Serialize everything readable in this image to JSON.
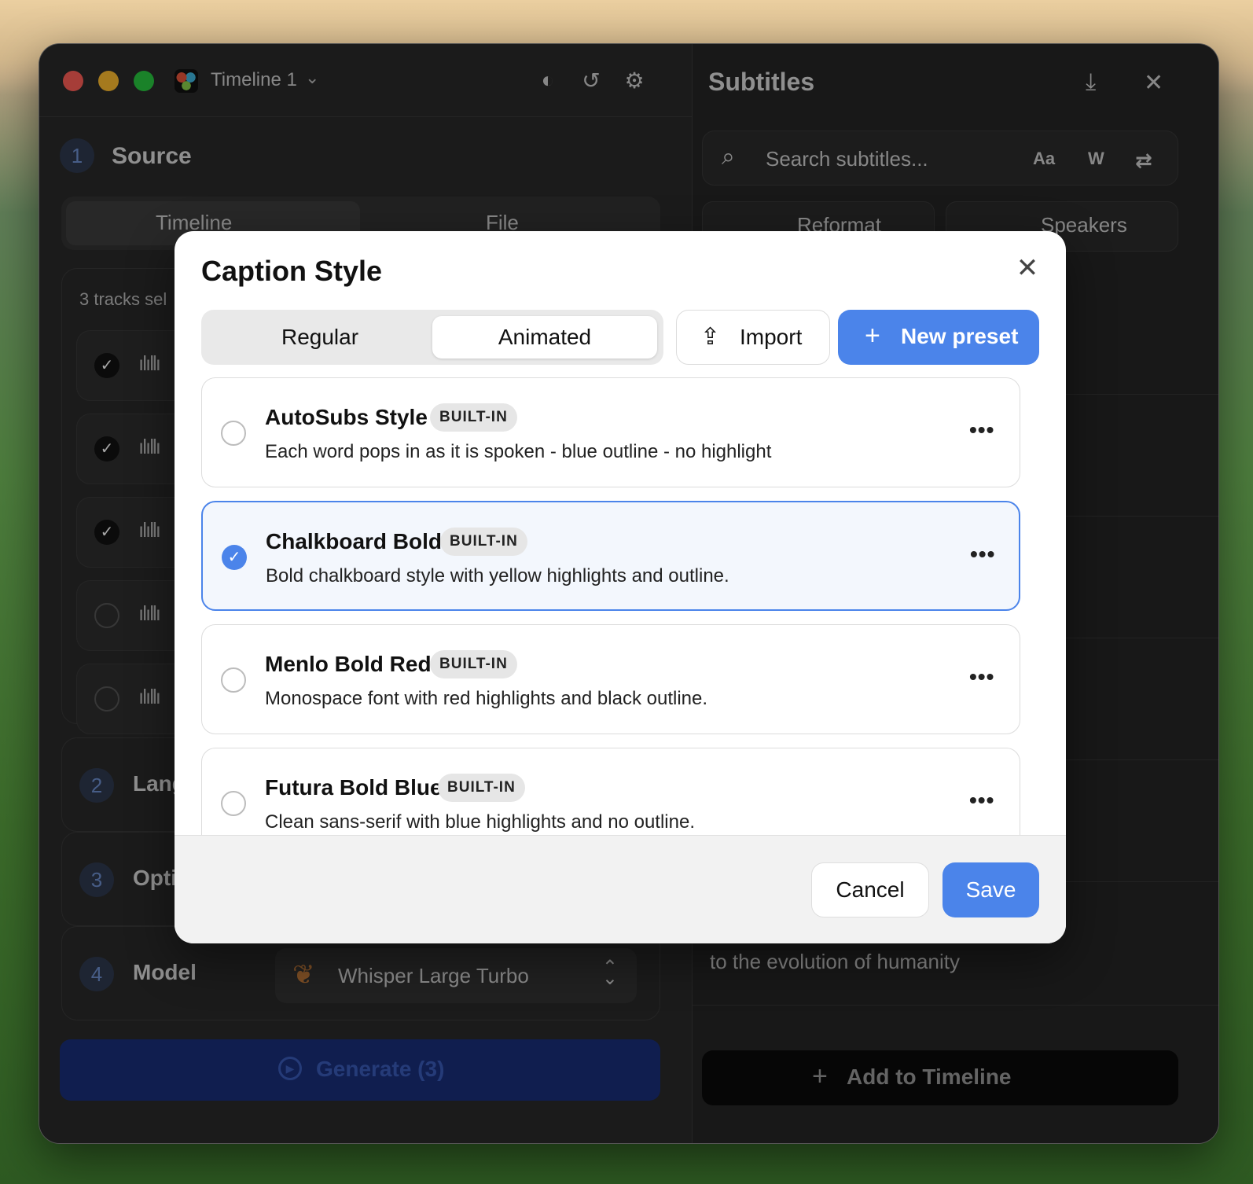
{
  "window": {
    "timeline_title": "Timeline 1"
  },
  "left": {
    "step1_num": "1",
    "step1_label": "Source",
    "source_tabs": [
      "Timeline",
      "File"
    ],
    "tracks_label": "3 tracks sel",
    "step2_num": "2",
    "step2_label": "Lang",
    "step3_num": "3",
    "step3_label": "Opti",
    "step4_num": "4",
    "step4_label": "Model",
    "model_value": "Whisper Large Turbo",
    "generate_label": "Generate (3)"
  },
  "right": {
    "title": "Subtitles",
    "search_placeholder": "Search subtitles...",
    "search_opt_case": "Aa",
    "search_opt_word": "W",
    "tab_reformat": "Reformat",
    "tab_speakers": "Speakers",
    "visible_subtitle": "to the evolution of humanity",
    "add_to_timeline": "Add to Timeline"
  },
  "modal": {
    "title": "Caption Style",
    "tabs": [
      "Regular",
      "Animated"
    ],
    "active_tab": "Animated",
    "import_label": "Import",
    "new_preset_label": "New preset",
    "presets": [
      {
        "name": "AutoSubs Style",
        "badge": "BUILT-IN",
        "description": "Each word pops in as it is spoken - blue outline - no highlight",
        "selected": false
      },
      {
        "name": "Chalkboard Bold",
        "badge": "BUILT-IN",
        "description": "Bold chalkboard style with yellow highlights and outline.",
        "selected": true
      },
      {
        "name": "Menlo Bold Red",
        "badge": "BUILT-IN",
        "description": "Monospace font with red highlights and black outline.",
        "selected": false
      },
      {
        "name": "Futura Bold Blue",
        "badge": "BUILT-IN",
        "description": "Clean sans-serif with blue highlights and no outline.",
        "selected": false
      }
    ],
    "cancel_label": "Cancel",
    "save_label": "Save"
  },
  "colors": {
    "accent": "#4b84ea",
    "window_bg": "#2b2b2b",
    "modal_bg": "#ffffff"
  }
}
